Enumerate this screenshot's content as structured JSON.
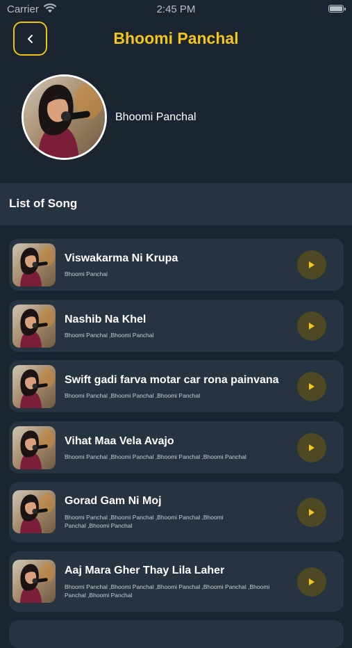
{
  "status_bar": {
    "carrier": "Carrier",
    "time": "2:45 PM"
  },
  "header": {
    "title": "Bhoomi Panchal",
    "back_icon": "chevron-left-icon"
  },
  "artist": {
    "name": "Bhoomi Panchal",
    "image": "artist-photo"
  },
  "section": {
    "title": "List of Song"
  },
  "colors": {
    "accent": "#f5c518",
    "background": "#1a2531",
    "card": "#263340",
    "play_bg": "#4e4923"
  },
  "songs": [
    {
      "title": "Viswakarma Ni Krupa",
      "artists": "Bhoomi Panchal"
    },
    {
      "title": "Nashib Na Khel",
      "artists": "Bhoomi Panchal ,Bhoomi Panchal"
    },
    {
      "title": "Swift gadi farva motar car rona painvana",
      "artists": "Bhoomi Panchal ,Bhoomi Panchal ,Bhoomi Panchal"
    },
    {
      "title": "Vihat Maa Vela Avajo",
      "artists": "Bhoomi Panchal ,Bhoomi Panchal ,Bhoomi Panchal ,Bhoomi Panchal"
    },
    {
      "title": "Gorad Gam Ni Moj",
      "artists": "Bhoomi Panchal ,Bhoomi Panchal ,Bhoomi Panchal ,Bhoomi Panchal ,Bhoomi Panchal"
    },
    {
      "title": "Aaj Mara Gher Thay Lila Laher",
      "artists": "Bhoomi Panchal ,Bhoomi Panchal ,Bhoomi Panchal ,Bhoomi Panchal ,Bhoomi Panchal ,Bhoomi Panchal"
    }
  ]
}
